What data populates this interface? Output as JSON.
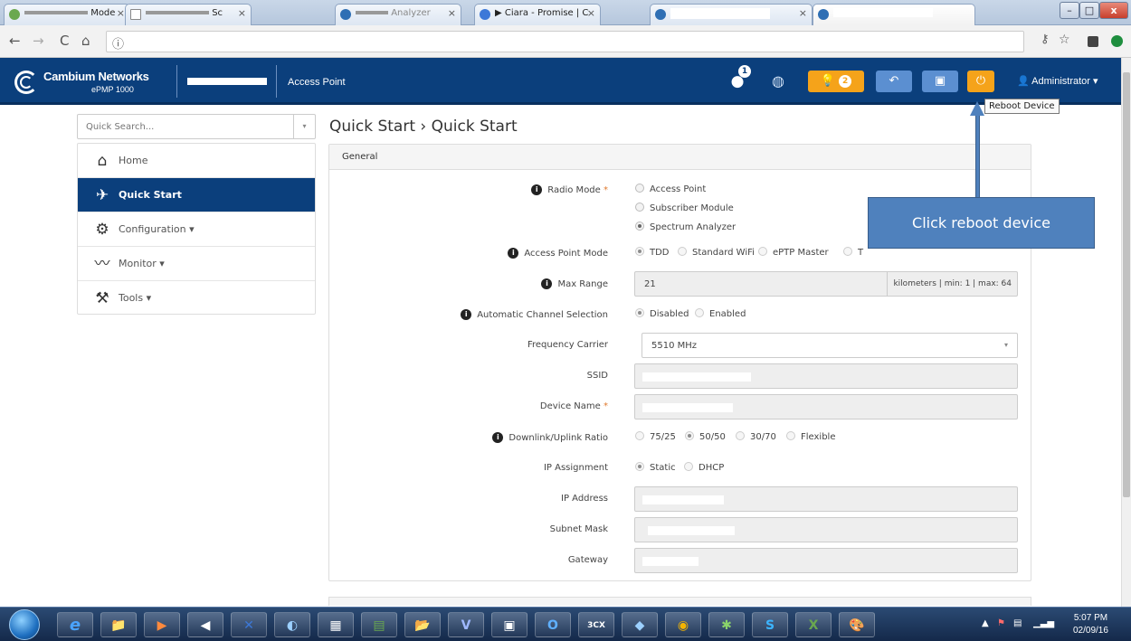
{
  "browser": {
    "tabs": [
      {
        "label": "Mode",
        "color": "#6aa84f"
      },
      {
        "label": "Sc",
        "color": "#888888"
      },
      {
        "label": "Analyzer",
        "color": "#2f6fb4"
      },
      {
        "label": "▶ Ciara - Promise | C",
        "color": "#3c78d8"
      },
      {
        "label": "",
        "color": "#2f6fb4"
      },
      {
        "label": "",
        "color": "#2f6fb4"
      }
    ],
    "tab_close": "×",
    "minimize": "–",
    "maximize": "□",
    "close": "x",
    "back": "←",
    "forward": "→",
    "reload": "C",
    "home": "⌂",
    "info": "ⓘ"
  },
  "header": {
    "brand": "Cambium Networks",
    "product": "ePMP 1000",
    "mode": "Access Point",
    "user_badge": "1",
    "alerts_count": "2",
    "admin_label": "Administrator",
    "tooltip": "Reboot Device"
  },
  "sidebar": {
    "search_placeholder": "Quick Search...",
    "items": [
      {
        "label": "Home",
        "icon": "home-icon",
        "glyph": "⌂"
      },
      {
        "label": "Quick Start",
        "icon": "running-icon",
        "glyph": "✈"
      },
      {
        "label": "Configuration ▾",
        "icon": "gear-icon",
        "glyph": "⚙"
      },
      {
        "label": "Monitor ▾",
        "icon": "pulse-icon",
        "glyph": "〰"
      },
      {
        "label": "Tools ▾",
        "icon": "wrench-icon",
        "glyph": "⚒"
      }
    ]
  },
  "main": {
    "title": "Quick Start › Quick Start",
    "panel_title": "General",
    "fields": {
      "radio_mode": {
        "label": "Radio Mode",
        "options": [
          "Access Point",
          "Subscriber Module",
          "Spectrum Analyzer"
        ],
        "selected": "Spectrum Analyzer"
      },
      "ap_mode": {
        "label": "Access Point Mode",
        "options": [
          "TDD",
          "Standard WiFi",
          "ePTP Master",
          "T"
        ],
        "selected": "TDD"
      },
      "max_range": {
        "label": "Max Range",
        "value": "21",
        "unit": "kilometers | min: 1 | max: 64"
      },
      "acs": {
        "label": "Automatic Channel Selection",
        "options": [
          "Disabled",
          "Enabled"
        ],
        "selected": "Disabled"
      },
      "freq": {
        "label": "Frequency Carrier",
        "value": "5510 MHz"
      },
      "ssid": {
        "label": "SSID"
      },
      "device_name": {
        "label": "Device Name"
      },
      "ratio": {
        "label": "Downlink/Uplink Ratio",
        "options": [
          "75/25",
          "50/50",
          "30/70",
          "Flexible"
        ],
        "selected": "50/50"
      },
      "ip_assign": {
        "label": "IP Assignment",
        "options": [
          "Static",
          "DHCP"
        ],
        "selected": "Static"
      },
      "ip": {
        "label": "IP Address"
      },
      "mask": {
        "label": "Subnet Mask"
      },
      "gateway": {
        "label": "Gateway"
      }
    },
    "required_mark": "*"
  },
  "annotation": {
    "text": "Click reboot device"
  },
  "taskbar": {
    "apps": [
      "e",
      "📁",
      "▶",
      "◀",
      "✕",
      "◐",
      "▦",
      "▤",
      "📂",
      "V",
      "▣",
      "O",
      "3CX",
      "◆",
      "◉",
      "✱",
      "S",
      "X",
      "🎨"
    ],
    "time": "5:07 PM",
    "date": "02/09/16"
  }
}
